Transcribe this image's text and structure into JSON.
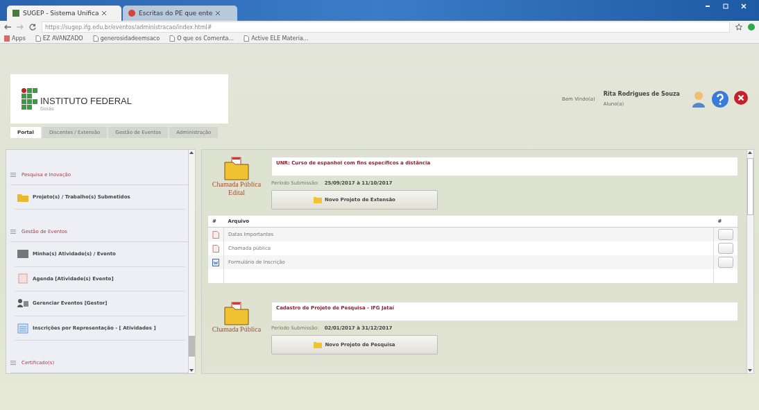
{
  "browser": {
    "tabs": [
      {
        "title": "SUGEP - Sistema Unifica",
        "selected": true
      },
      {
        "title": "Escritas do PE que ente",
        "selected": false
      }
    ],
    "url": "https://sugep.ifg.edu.br/eventos/administracao/index.html#",
    "bookmarks": [
      "Apps",
      "EZ AVANZADO",
      "generosidadeemsaco",
      "O que os Comenta...",
      "Active ELE Materia..."
    ]
  },
  "header": {
    "logo_title": "INSTITUTO FEDERAL",
    "logo_subtitle": "Goiás",
    "welcome": "Bem Vindo(a)",
    "user_name": "Rita Rodrigues de Souza",
    "user_role": "Aluno(a)"
  },
  "nav_tabs": [
    {
      "label": "Portal",
      "selected": true
    },
    {
      "label": "Discentes / Extensão",
      "selected": false
    },
    {
      "label": "Gestão de Eventos",
      "selected": false
    },
    {
      "label": "Administração",
      "selected": false
    }
  ],
  "sidebar": {
    "items": [
      {
        "kind": "section",
        "label": "Pesquisa e Inovação"
      },
      {
        "kind": "link",
        "label": "Projeto(s) / Trabalho(s) Submetidos"
      },
      {
        "kind": "section",
        "label": "Gestão de Eventos"
      },
      {
        "kind": "link",
        "label": "Minha(s) Atividade(s) / Evento"
      },
      {
        "kind": "link",
        "label": "Agenda [Atividade(s) Evento]"
      },
      {
        "kind": "link",
        "label": "Gerenciar Eventos [Gestor]"
      },
      {
        "kind": "link",
        "label": "Inscrições por Representação - [ Atividades ]"
      },
      {
        "kind": "section",
        "label": "Certificado(s)"
      }
    ]
  },
  "calls": [
    {
      "caption": "Chamada Pública",
      "caption_2": "Edital",
      "title": "UNR: Curso de espanhol com fins específicos a distância",
      "period_label": "Período Submissão:",
      "period": "25/09/2017 à 11/10/2017",
      "button": "Novo Projeto de Extensão",
      "files": {
        "columns": [
          "#",
          "Arquivo",
          "#"
        ],
        "rows": [
          {
            "kind": "pdf",
            "name": "Datas Importantes"
          },
          {
            "kind": "pdf",
            "name": "Chamada pública"
          },
          {
            "kind": "doc",
            "name": "Formulário de Inscrição"
          }
        ]
      }
    },
    {
      "caption": "Chamada Pública",
      "title": "Cadastro de Projeto de Pesquisa - IFG Jataí",
      "period_label": "Período Submissão:",
      "period": "02/01/2017 à 31/12/2017",
      "button": "Novo Projeto de Pesquisa"
    }
  ]
}
